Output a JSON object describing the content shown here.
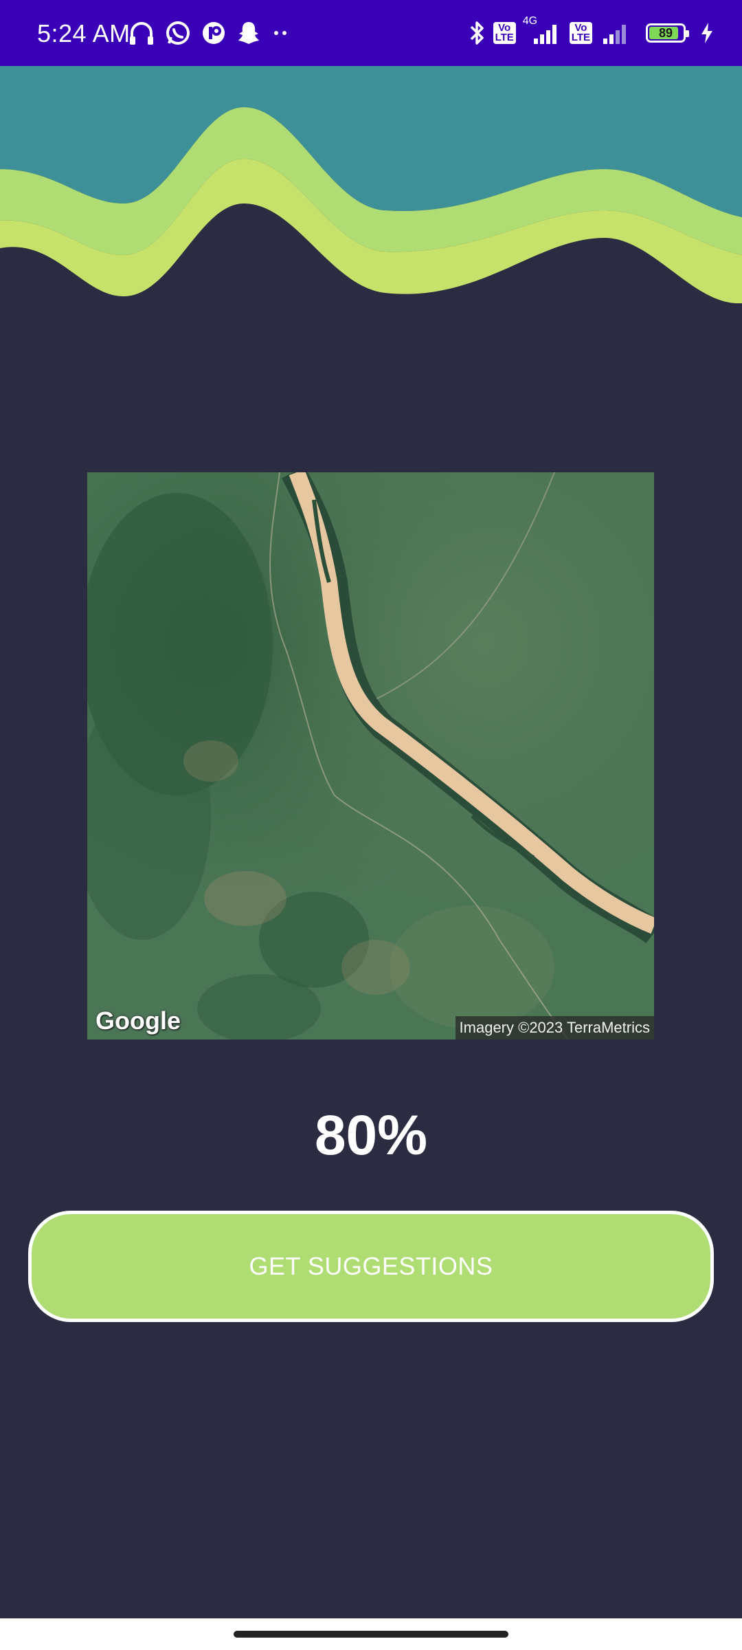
{
  "status_bar": {
    "time": "5:24 AM",
    "network": "4G",
    "volte_1": "Vo\nLTE",
    "volte_2": "Vo\nLTE",
    "battery_level": 89,
    "battery_text": "89",
    "icons_left": [
      "headphones-icon",
      "whatsapp-icon",
      "pocket-icon",
      "snapchat-icon",
      "more-dots-icon"
    ],
    "icons_right": [
      "bluetooth-icon",
      "volte-icon",
      "signal-icon",
      "volte-icon",
      "signal-icon",
      "battery-icon",
      "charging-icon"
    ]
  },
  "map": {
    "logo": "Google",
    "attribution": "Imagery ©2023 TerraMetrics"
  },
  "result": {
    "percent": "80%"
  },
  "actions": {
    "get_suggestions_label": "GET SUGGESTIONS"
  },
  "colors": {
    "status_bar": "#3a00b8",
    "background": "#2b2c41",
    "wave_teal": "#3d9097",
    "wave_green": "#b0dd73",
    "wave_lime": "#c7e26a",
    "button": "#b0dd73"
  }
}
